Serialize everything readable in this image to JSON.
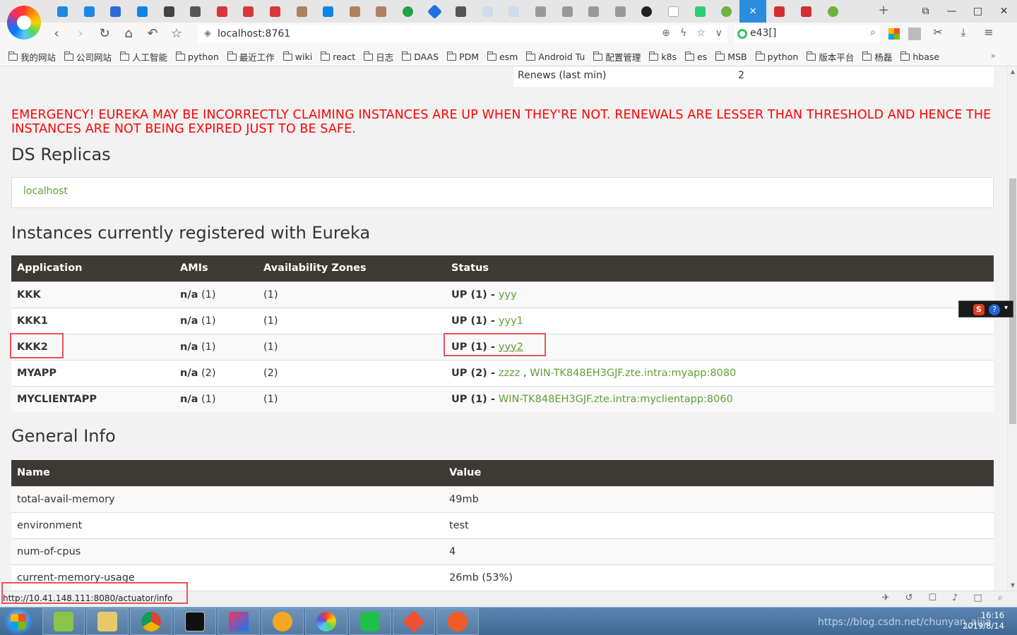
{
  "browser": {
    "address": "localhost:8761",
    "search_value": "e43[]",
    "window_controls": [
      "⧉",
      "—",
      "□",
      "✕"
    ],
    "tab_close_glyph": "✕",
    "new_tab_glyph": "+"
  },
  "bookmarks": [
    "我的网站",
    "公司网站",
    "人工智能",
    "python",
    "最近工作",
    "wiki",
    "react",
    "日志",
    "DAAS",
    "PDM",
    "esm",
    "Android Tu",
    "配置管理",
    "k8s",
    "es",
    "MSB",
    "python",
    "版本平台",
    "杨磊",
    "hbase"
  ],
  "bookmarks_more": "»",
  "renews": {
    "label": "Renews (last min)",
    "value": "2"
  },
  "emergency": "EMERGENCY! EUREKA MAY BE INCORRECTLY CLAIMING INSTANCES ARE UP WHEN THEY'RE NOT. RENEWALS ARE LESSER THAN THRESHOLD AND HENCE THE INSTANCES ARE NOT BEING EXPIRED JUST TO BE SAFE.",
  "ds_replicas": {
    "title": "DS Replicas",
    "replica": "localhost"
  },
  "instances": {
    "title": "Instances currently registered with Eureka",
    "headers": [
      "Application",
      "AMIs",
      "Availability Zones",
      "Status"
    ],
    "rows": [
      {
        "application": "KKK",
        "amis_label": "n/a",
        "amis_count": "(1)",
        "zones": "(1)",
        "status_prefix": "UP (1) - ",
        "status_link": "yyy"
      },
      {
        "application": "KKK1",
        "amis_label": "n/a",
        "amis_count": "(1)",
        "zones": "(1)",
        "status_prefix": "UP (1) - ",
        "status_link": "yyy1"
      },
      {
        "application": "KKK2",
        "amis_label": "n/a",
        "amis_count": "(1)",
        "zones": "(1)",
        "status_prefix": "UP (1) - ",
        "status_link": "yyy2"
      },
      {
        "application": "MYAPP",
        "amis_label": "n/a",
        "amis_count": "(2)",
        "zones": "(2)",
        "status_prefix": "UP (2) - ",
        "status_link": "zzzz",
        "status_sep": " , ",
        "status_link2": "WIN-TK848EH3GJF.zte.intra:myapp:8080"
      },
      {
        "application": "MYCLIENTAPP",
        "amis_label": "n/a",
        "amis_count": "(1)",
        "zones": "(1)",
        "status_prefix": "UP (1) - ",
        "status_link": "WIN-TK848EH3GJF.zte.intra:myclientapp:8060"
      }
    ]
  },
  "general_info": {
    "title": "General Info",
    "headers": [
      "Name",
      "Value"
    ],
    "rows": [
      {
        "name": "total-avail-memory",
        "value": "49mb"
      },
      {
        "name": "environment",
        "value": "test"
      },
      {
        "name": "num-of-cpus",
        "value": "4"
      },
      {
        "name": "current-memory-usage",
        "value": "26mb (53%)"
      }
    ]
  },
  "status_bar": {
    "url": "http://10.41.148.111:8080/actuator/info"
  },
  "taskbar": {
    "clock_time": "16:16",
    "clock_date": "2019/8/14",
    "watermark": "https://blog.csdn.net/chunyan_aijia"
  },
  "colors": {
    "link": "#5fa134",
    "emergency": "#ff0000",
    "table_header": "#3d3935",
    "annotation": "#e8525b"
  }
}
